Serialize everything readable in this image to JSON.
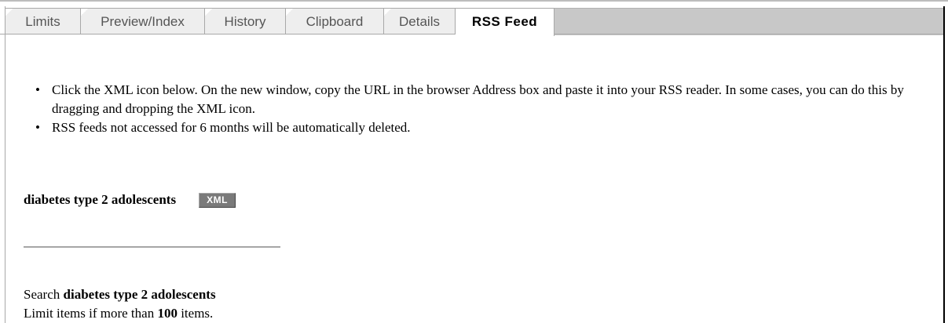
{
  "tabs": [
    {
      "label": "Limits",
      "active": false
    },
    {
      "label": "Preview/Index",
      "active": false
    },
    {
      "label": "History",
      "active": false
    },
    {
      "label": "Clipboard",
      "active": false
    },
    {
      "label": "Details",
      "active": false
    },
    {
      "label": "RSS Feed",
      "active": true
    }
  ],
  "instructions": [
    "Click the XML icon below. On the new window, copy the URL in the browser Address box and paste it into your RSS reader. In some cases, you can do this by dragging and dropping the XML icon.",
    "RSS feeds not accessed for 6 months will be automatically deleted."
  ],
  "feed": {
    "name": "diabetes type 2 adolescents",
    "xml_label": "XML"
  },
  "search_info": {
    "search_prefix": "Search",
    "search_term": "diabetes type 2 adolescents",
    "limit_prefix": "Limit items if more than",
    "limit_count": "100",
    "limit_suffix": "items."
  },
  "colors": {
    "tab_inactive_bg": "#eeeeee",
    "tab_active_bg": "#ffffff",
    "tabstrip_fill": "#c8c8c8",
    "xml_badge_bg": "#7a7a7a"
  }
}
